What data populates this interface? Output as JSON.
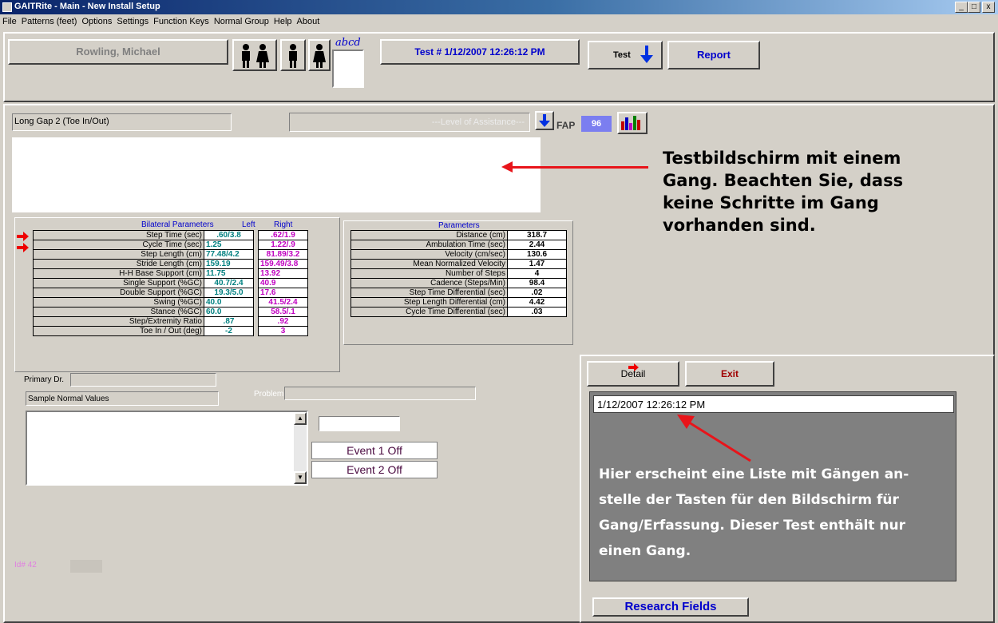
{
  "window": {
    "title": "GAITRite - Main - New Install Setup",
    "min": "_",
    "max": "□",
    "close": "x"
  },
  "menu": [
    "File",
    "Patterns (feet)",
    "Options",
    "Settings",
    "Function Keys",
    "Normal Group",
    "Help",
    "About"
  ],
  "toolbar": {
    "patient": "Rowling, Michael",
    "abcd": "abcd",
    "test": "Test # 1/12/2007 12:26:12 PM",
    "test_btn": "Test",
    "report": "Report"
  },
  "walk": {
    "title": "Long Gap 2 (Toe In/Out)",
    "assistance": "---Level of Assistance---",
    "fap_label": "FAP",
    "fap_value": "96"
  },
  "bilateral": {
    "header": "Bilateral Parameters",
    "left": "Left",
    "right": "Right",
    "rows": [
      {
        "label": "Step Time (sec)",
        "left": ".60/3.8",
        "right": ".62/1.9"
      },
      {
        "label": "Cycle Time (sec)",
        "left": "1.25",
        "right": "1.22/.9"
      },
      {
        "label": "Step Length (cm)",
        "left": "77.48/4.2",
        "right": "81.89/3.2"
      },
      {
        "label": "Stride Length (cm)",
        "left": "159.19",
        "right": "159.49/3.8"
      },
      {
        "label": "H-H Base Support (cm)",
        "left": "11.75",
        "right": "13.92"
      },
      {
        "label": "Single Support (%GC)",
        "left": "40.7/2.4",
        "right": "40.9"
      },
      {
        "label": "Double Support (%GC)",
        "left": "19.3/5.0",
        "right": "17.6"
      },
      {
        "label": "Swing (%GC)",
        "left": "40.0",
        "right": "41.5/2.4"
      },
      {
        "label": "Stance (%GC)",
        "left": "60.0",
        "right": "58.5/.1"
      },
      {
        "label": "Step/Extremity Ratio",
        "left": ".87",
        "right": ".92"
      },
      {
        "label": "Toe In / Out (deg)",
        "left": "-2",
        "right": "3"
      }
    ]
  },
  "parameters": {
    "header": "Parameters",
    "rows": [
      {
        "label": "Distance (cm)",
        "value": "318.7"
      },
      {
        "label": "Ambulation Time (sec)",
        "value": "2.44"
      },
      {
        "label": "Velocity (cm/sec)",
        "value": "130.6"
      },
      {
        "label": "Mean Normalized Velocity",
        "value": "1.47"
      },
      {
        "label": "Number of Steps",
        "value": "4"
      },
      {
        "label": "Cadence (Steps/Min)",
        "value": "98.4"
      },
      {
        "label": "Step Time Differential (sec)",
        "value": ".02"
      },
      {
        "label": "Step Length Differential (cm)",
        "value": "4.42"
      },
      {
        "label": "Cycle Time Differential (sec)",
        "value": ".03"
      }
    ]
  },
  "lower": {
    "primary_dr": "Primary Dr.",
    "sample_normal": "Sample Normal Values",
    "problem": "Problem",
    "event1": "Event 1 Off",
    "event2": "Event 2 Off",
    "id": "Id# 42"
  },
  "panel": {
    "detail": "Detail",
    "exit": "Exit",
    "walk_item": "1/12/2007 12:26:12 PM",
    "research": "Research Fields"
  },
  "annotations": {
    "top": "Testbildschirm mit einem Gang. Beachten Sie, dass keine Schritte im Gang vorhanden sind.",
    "bottom": "Hier erscheint eine Liste mit Gängen an-stelle der Tasten für den Bildschirm für Gang/Erfassung. Dieser Test enthält nur einen Gang."
  },
  "colors": {
    "title_bar": "#0a246a",
    "accent_blue": "#0000cc",
    "teal": "#008080",
    "magenta": "#c000c0",
    "annotation_arrow": "#e8141a",
    "walk_list_bg": "#808080"
  }
}
